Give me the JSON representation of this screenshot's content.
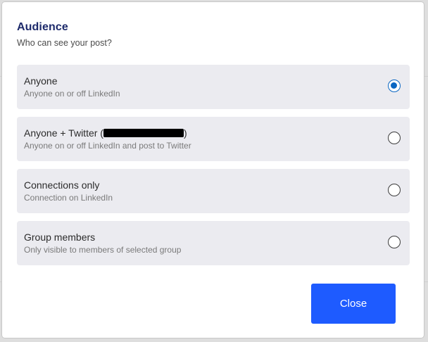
{
  "dialog": {
    "title": "Audience",
    "subtitle": "Who can see your post?"
  },
  "options": [
    {
      "label": "Anyone",
      "description": "Anyone on or off LinkedIn",
      "selected": true
    },
    {
      "label_prefix": "Anyone + Twitter (",
      "label_suffix": ")",
      "description": "Anyone on or off LinkedIn and post to Twitter",
      "selected": false
    },
    {
      "label": "Connections only",
      "description": "Connection on LinkedIn",
      "selected": false
    },
    {
      "label": "Group members",
      "description": "Only visible to members of selected group",
      "selected": false
    }
  ],
  "close_button": {
    "label": "Close"
  },
  "colors": {
    "accent": "#1e5bff",
    "radio_selected": "#0a66c2",
    "option_background": "#ebebf0",
    "title": "#1d2a6b"
  }
}
